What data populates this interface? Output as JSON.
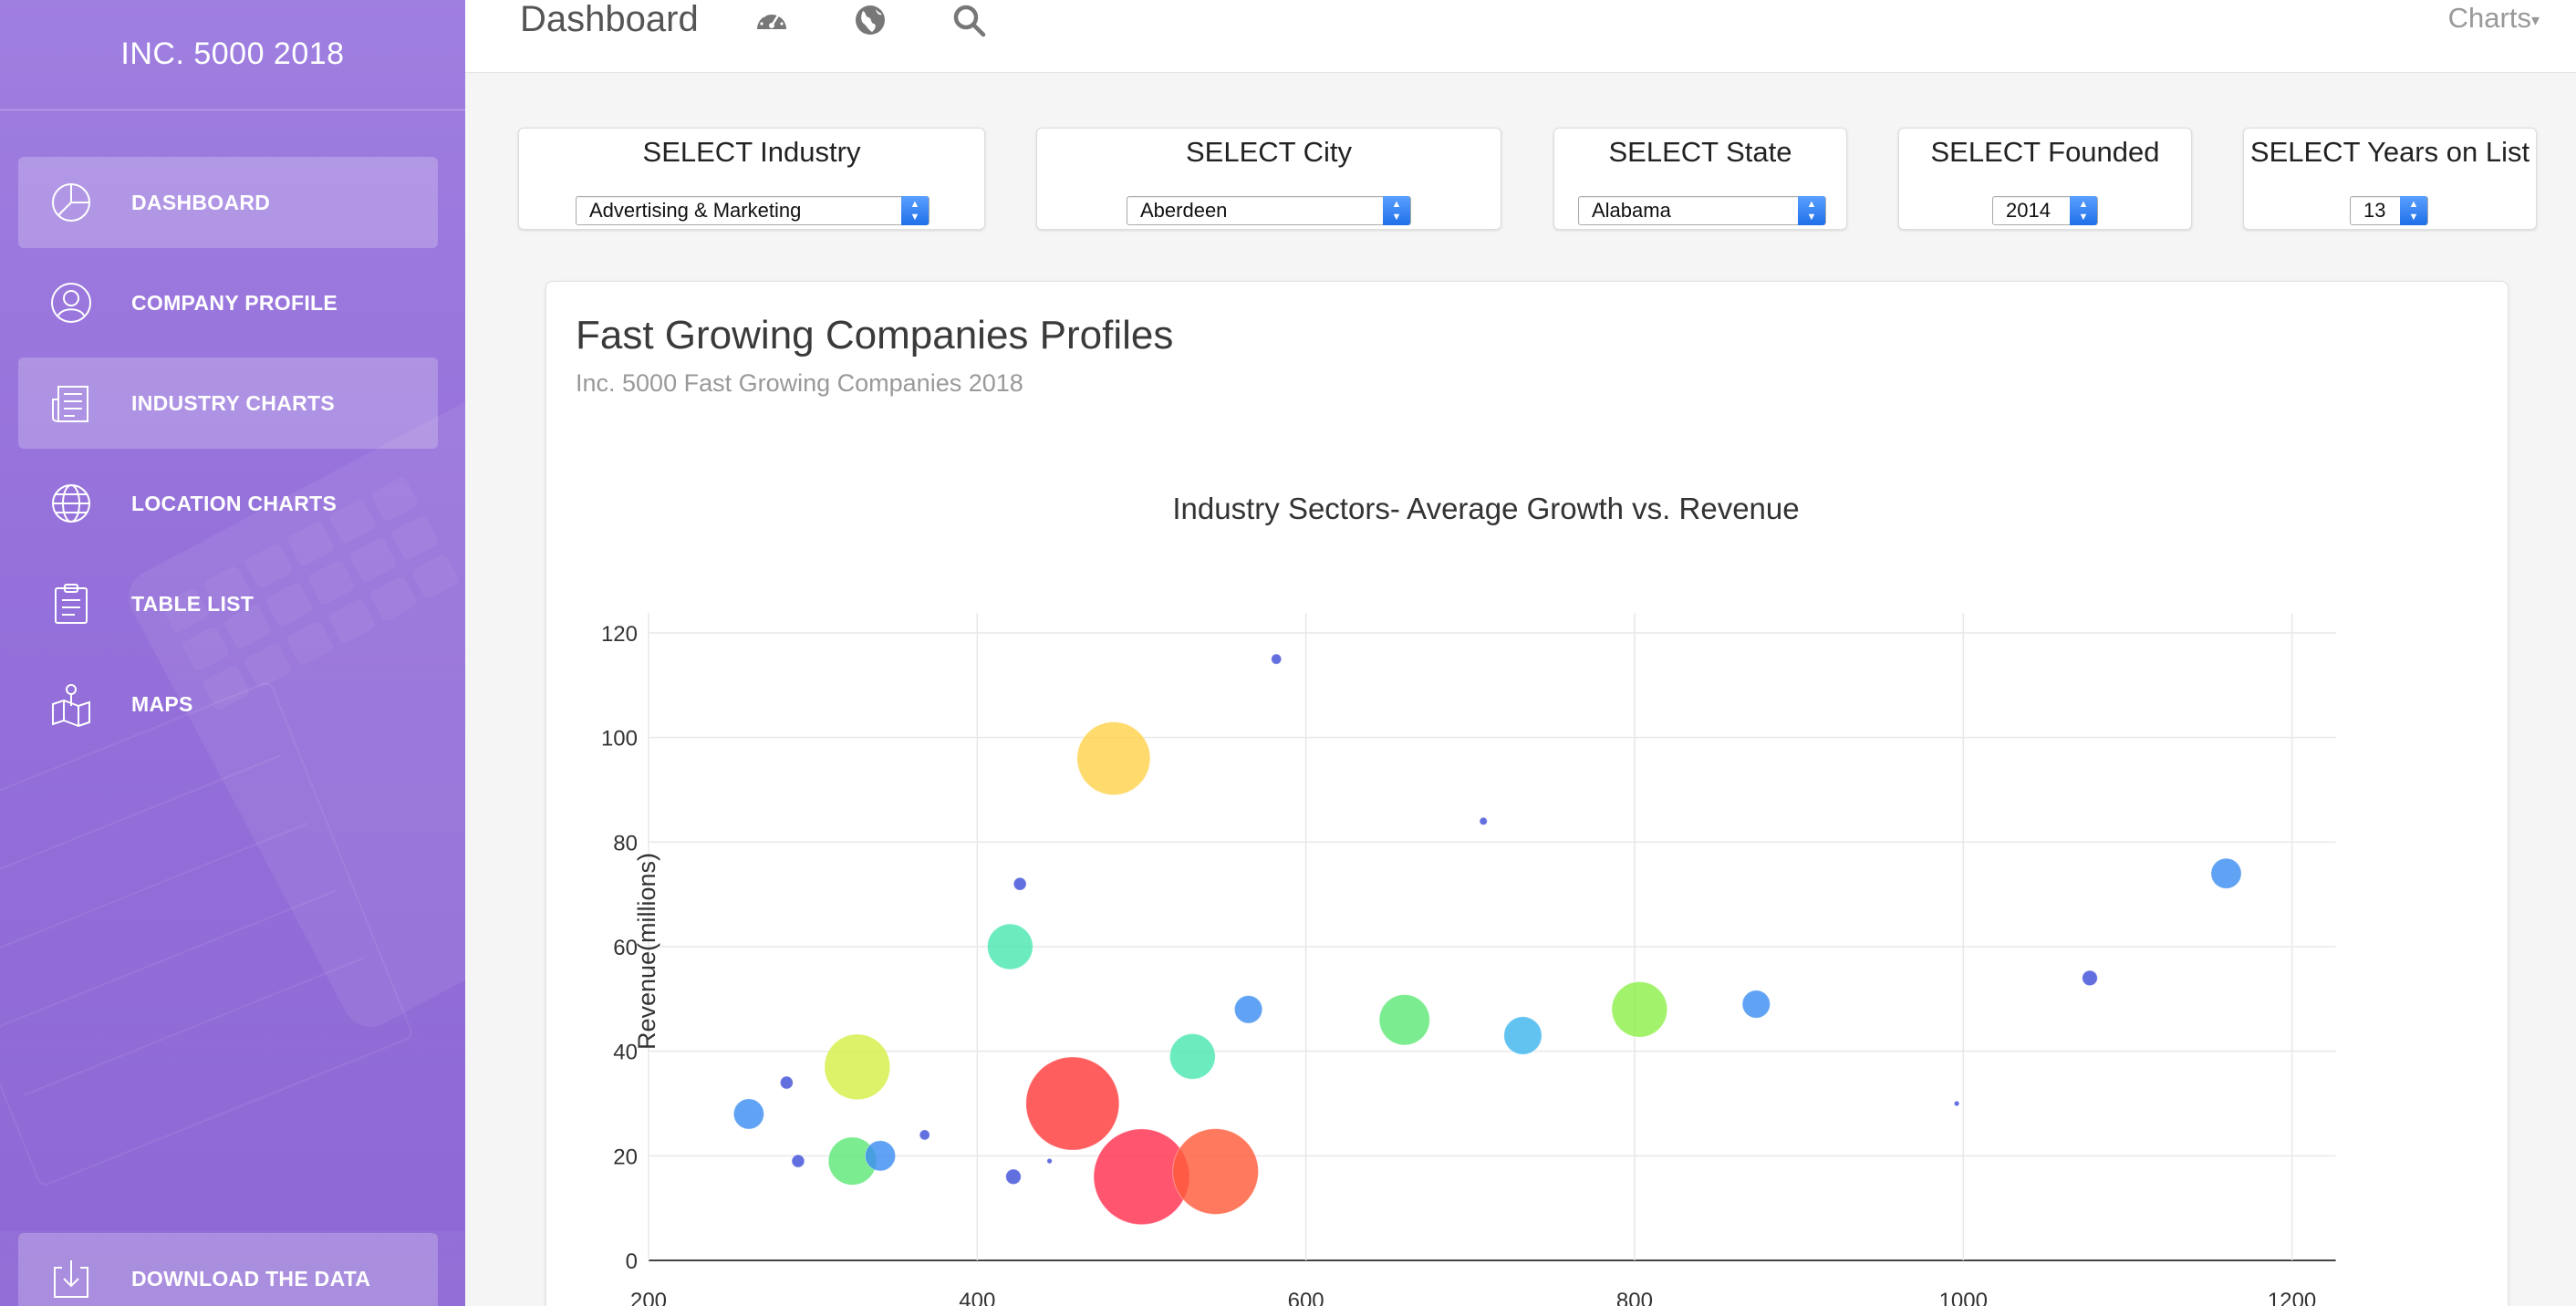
{
  "sidebar": {
    "brand": "INC. 5000 2018",
    "items": [
      {
        "label": "DASHBOARD",
        "icon": "pie-chart-icon",
        "active": true
      },
      {
        "label": "COMPANY PROFILE",
        "icon": "user-icon",
        "active": false
      },
      {
        "label": "INDUSTRY CHARTS",
        "icon": "newspaper-icon",
        "active": true
      },
      {
        "label": "LOCATION CHARTS",
        "icon": "globe-icon",
        "active": false
      },
      {
        "label": "TABLE LIST",
        "icon": "clipboard-icon",
        "active": false
      },
      {
        "label": "MAPS",
        "icon": "map-icon",
        "active": false
      }
    ],
    "download": {
      "label": "DOWNLOAD THE DATA",
      "icon": "download-icon"
    }
  },
  "navbar": {
    "title": "Dashboard",
    "icons": [
      "dashboard-gauge-icon",
      "globe-icon",
      "search-icon"
    ],
    "menu_label": "Charts"
  },
  "filters": [
    {
      "label": "SELECT Industry",
      "value": "Advertising & Marketing"
    },
    {
      "label": "SELECT City",
      "value": "Aberdeen"
    },
    {
      "label": "SELECT State",
      "value": "Alabama"
    },
    {
      "label": "SELECT Founded",
      "value": "2014"
    },
    {
      "label": "SELECT Years on List",
      "value": "13"
    }
  ],
  "card": {
    "title": "Fast Growing Companies Profiles",
    "subtitle": "Inc. 5000 Fast Growing Companies 2018"
  },
  "colors": {
    "sidebar_top": "#9f7fe0",
    "sidebar_bottom": "#7f55cf",
    "select_arrow": "#2f7cf0"
  },
  "chart_data": {
    "type": "scatter",
    "title": "Industry Sectors- Average Growth vs. Revenue",
    "xlabel": "",
    "ylabel": "Revenue(millions)",
    "xlim": [
      200,
      1200
    ],
    "ylim": [
      0,
      120
    ],
    "xticks": [
      200,
      400,
      600,
      800,
      1000,
      1200
    ],
    "yticks": [
      0,
      20,
      40,
      60,
      80,
      100,
      120
    ],
    "grid": true,
    "points": [
      {
        "x": 582,
        "y": 115,
        "size": 4,
        "color": "#3f4fd8"
      },
      {
        "x": 483,
        "y": 96,
        "size": 29,
        "color": "#ffd24d"
      },
      {
        "x": 708,
        "y": 84,
        "size": 3,
        "color": "#3f4fd8"
      },
      {
        "x": 426,
        "y": 72,
        "size": 5,
        "color": "#3f4fd8"
      },
      {
        "x": 1160,
        "y": 74,
        "size": 12,
        "color": "#3d8ef0"
      },
      {
        "x": 420,
        "y": 60,
        "size": 18,
        "color": "#4ce8b0"
      },
      {
        "x": 1077,
        "y": 54,
        "size": 6,
        "color": "#3f4fd8"
      },
      {
        "x": 565,
        "y": 48,
        "size": 11,
        "color": "#3d8ef0"
      },
      {
        "x": 874,
        "y": 49,
        "size": 11,
        "color": "#3d8ef0"
      },
      {
        "x": 803,
        "y": 48,
        "size": 22,
        "color": "#8ef04a"
      },
      {
        "x": 660,
        "y": 46,
        "size": 20,
        "color": "#5ee878"
      },
      {
        "x": 732,
        "y": 43,
        "size": 15,
        "color": "#3fb6ee"
      },
      {
        "x": 531,
        "y": 39,
        "size": 18,
        "color": "#4ce8b0"
      },
      {
        "x": 327,
        "y": 37,
        "size": 26,
        "color": "#d6ef48"
      },
      {
        "x": 284,
        "y": 34,
        "size": 5,
        "color": "#3f4fd8"
      },
      {
        "x": 261,
        "y": 28,
        "size": 12,
        "color": "#3d8ef0"
      },
      {
        "x": 458,
        "y": 30,
        "size": 37,
        "color": "#ff3b3b"
      },
      {
        "x": 368,
        "y": 24,
        "size": 4,
        "color": "#3f4fd8"
      },
      {
        "x": 341,
        "y": 20,
        "size": 12,
        "color": "#3d8ef0"
      },
      {
        "x": 324,
        "y": 19,
        "size": 19,
        "color": "#5ee878"
      },
      {
        "x": 291,
        "y": 19,
        "size": 5,
        "color": "#3f4fd8"
      },
      {
        "x": 545,
        "y": 17,
        "size": 34,
        "color": "#ff5b3b"
      },
      {
        "x": 500,
        "y": 16,
        "size": 38,
        "color": "#ff2f4f"
      },
      {
        "x": 444,
        "y": 19,
        "size": 2,
        "color": "#3f4fd8"
      },
      {
        "x": 422,
        "y": 16,
        "size": 6,
        "color": "#3f4fd8"
      },
      {
        "x": 996,
        "y": 30,
        "size": 2,
        "color": "#3f4fd8"
      }
    ]
  }
}
